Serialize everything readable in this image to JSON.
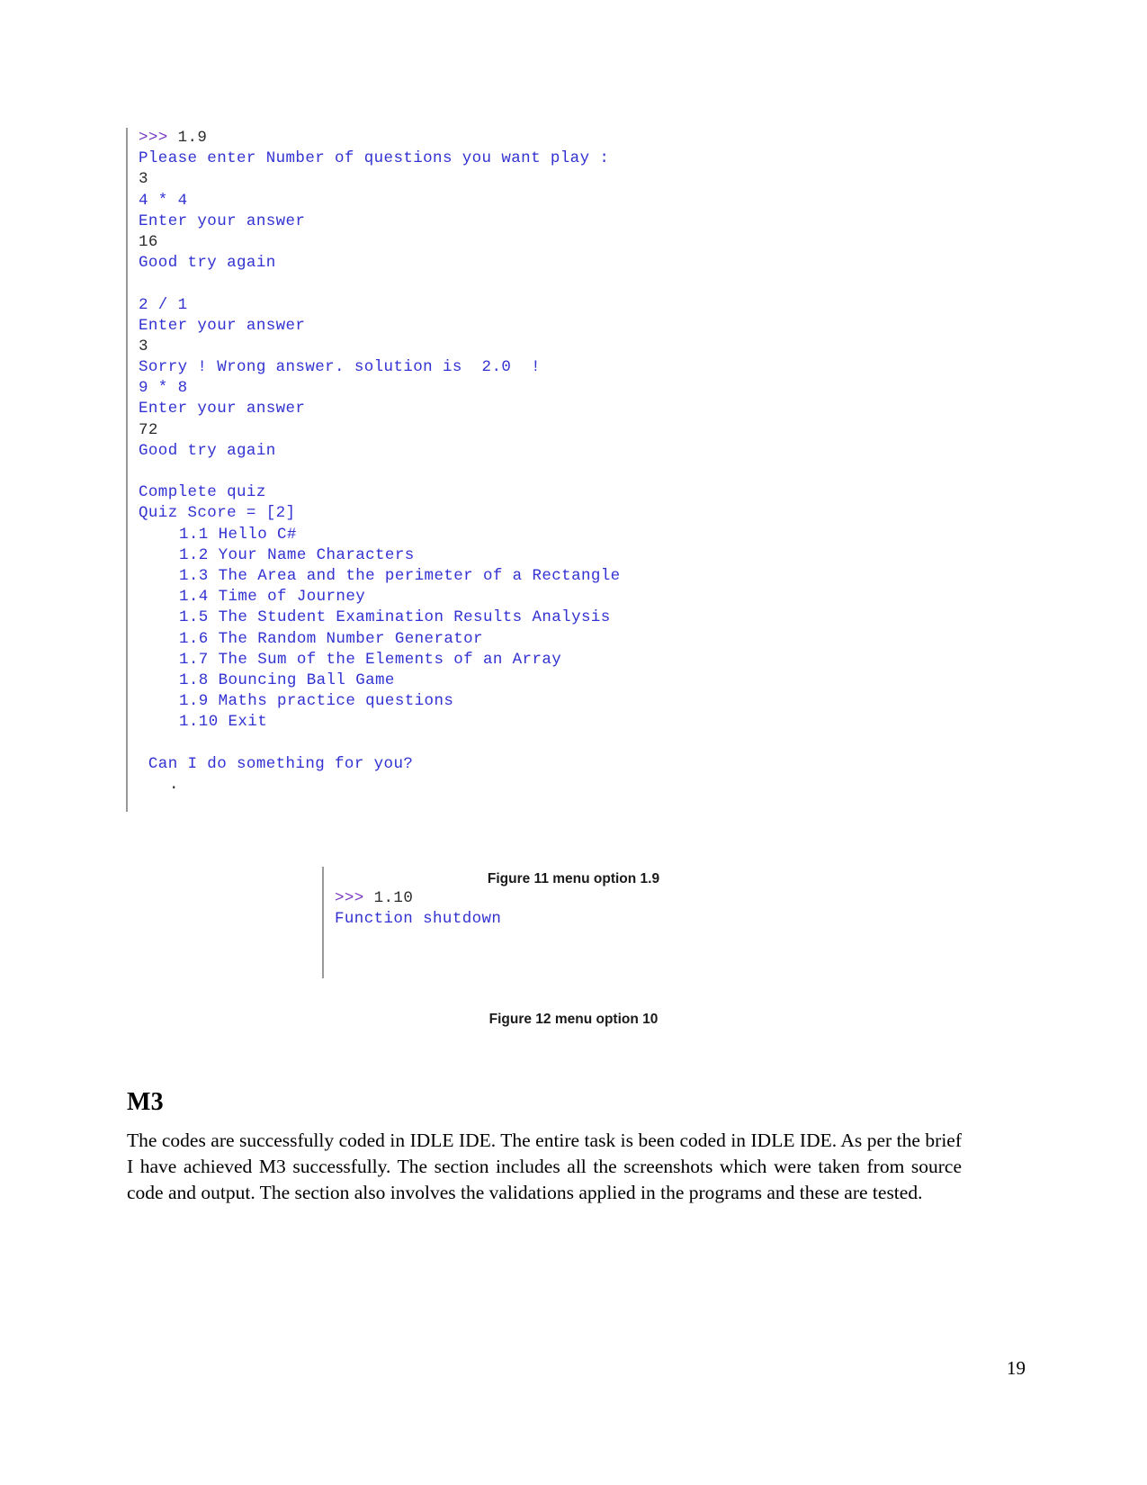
{
  "document": {
    "page_number": "19"
  },
  "console_1": {
    "lines": [
      {
        "type": "prompt",
        "prompt": ">>>",
        "input": " 1.9"
      },
      {
        "type": "output",
        "text": "Please enter Number of questions you want play :"
      },
      {
        "type": "input",
        "text": "3"
      },
      {
        "type": "output",
        "text": "4 * 4"
      },
      {
        "type": "output",
        "text": "Enter your answer"
      },
      {
        "type": "input",
        "text": "16"
      },
      {
        "type": "output",
        "text": "Good try again"
      },
      {
        "type": "blank",
        "text": ""
      },
      {
        "type": "output",
        "text": "2 / 1"
      },
      {
        "type": "output",
        "text": "Enter your answer"
      },
      {
        "type": "input",
        "text": "3"
      },
      {
        "type": "output",
        "text": "Sorry ! Wrong answer. solution is  2.0  !"
      },
      {
        "type": "output",
        "text": "9 * 8"
      },
      {
        "type": "output",
        "text": "Enter your answer"
      },
      {
        "type": "input",
        "text": "72"
      },
      {
        "type": "output",
        "text": "Good try again"
      },
      {
        "type": "blank",
        "text": ""
      },
      {
        "type": "output",
        "text": "Complete quiz"
      },
      {
        "type": "output",
        "text": "Quiz Score = [2]"
      },
      {
        "type": "menu",
        "text": "1.1 Hello C#"
      },
      {
        "type": "menu",
        "text": "1.2 Your Name Characters"
      },
      {
        "type": "menu",
        "text": "1.3 The Area and the perimeter of a Rectangle"
      },
      {
        "type": "menu",
        "text": "1.4 Time of Journey"
      },
      {
        "type": "menu",
        "text": "1.5 The Student Examination Results Analysis"
      },
      {
        "type": "menu",
        "text": "1.6 The Random Number Generator"
      },
      {
        "type": "menu",
        "text": "1.7 The Sum of the Elements of an Array"
      },
      {
        "type": "menu",
        "text": "1.8 Bouncing Ball Game"
      },
      {
        "type": "menu",
        "text": "1.9 Maths practice questions"
      },
      {
        "type": "menu",
        "text": "1.10 Exit"
      },
      {
        "type": "blank",
        "text": ""
      },
      {
        "type": "output",
        "text": " Can I do something for you?"
      },
      {
        "type": "dot",
        "text": "."
      }
    ]
  },
  "console_2": {
    "lines": [
      {
        "type": "prompt",
        "prompt": ">>>",
        "input": " 1.10"
      },
      {
        "type": "output",
        "text": "Function shutdown"
      }
    ]
  },
  "captions": {
    "figure_11": "Figure 11 menu option 1.9",
    "figure_12": "Figure 12 menu option 10"
  },
  "section": {
    "heading": "M3",
    "paragraph": "The codes are successfully coded in IDLE IDE. The entire task is been coded in IDLE IDE. As per the brief I have achieved M3 successfully. The section includes all the screenshots which were taken from source code and output. The section also involves the validations applied in the programs and these are tested."
  },
  "colors": {
    "output_blue": "#3232d2",
    "prompt_purple": "#7335c2",
    "input_dark": "#2b2b2b",
    "border_gray": "#999999"
  }
}
